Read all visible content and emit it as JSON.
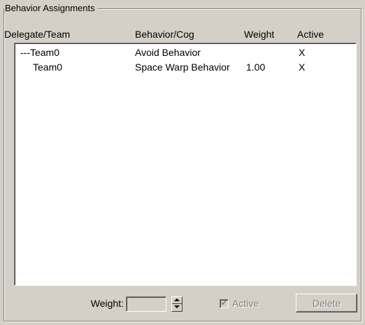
{
  "group": {
    "title": "Behavior Assignments"
  },
  "columns": [
    "Delegate/Team",
    "Behavior/Cog",
    "Weight",
    "Active"
  ],
  "rows": [
    {
      "delegate": "---Team0",
      "behavior": "Avoid Behavior",
      "weight": "",
      "active": "X"
    },
    {
      "delegate": "Team0",
      "behavior": "Space Warp Behavior",
      "weight": "1.00",
      "active": "X"
    }
  ],
  "controls": {
    "weight_label": "Weight:",
    "weight_value": "",
    "active_label": "Active",
    "active_checked": true,
    "active_check_glyph": "✔",
    "delete_label": "Delete"
  }
}
